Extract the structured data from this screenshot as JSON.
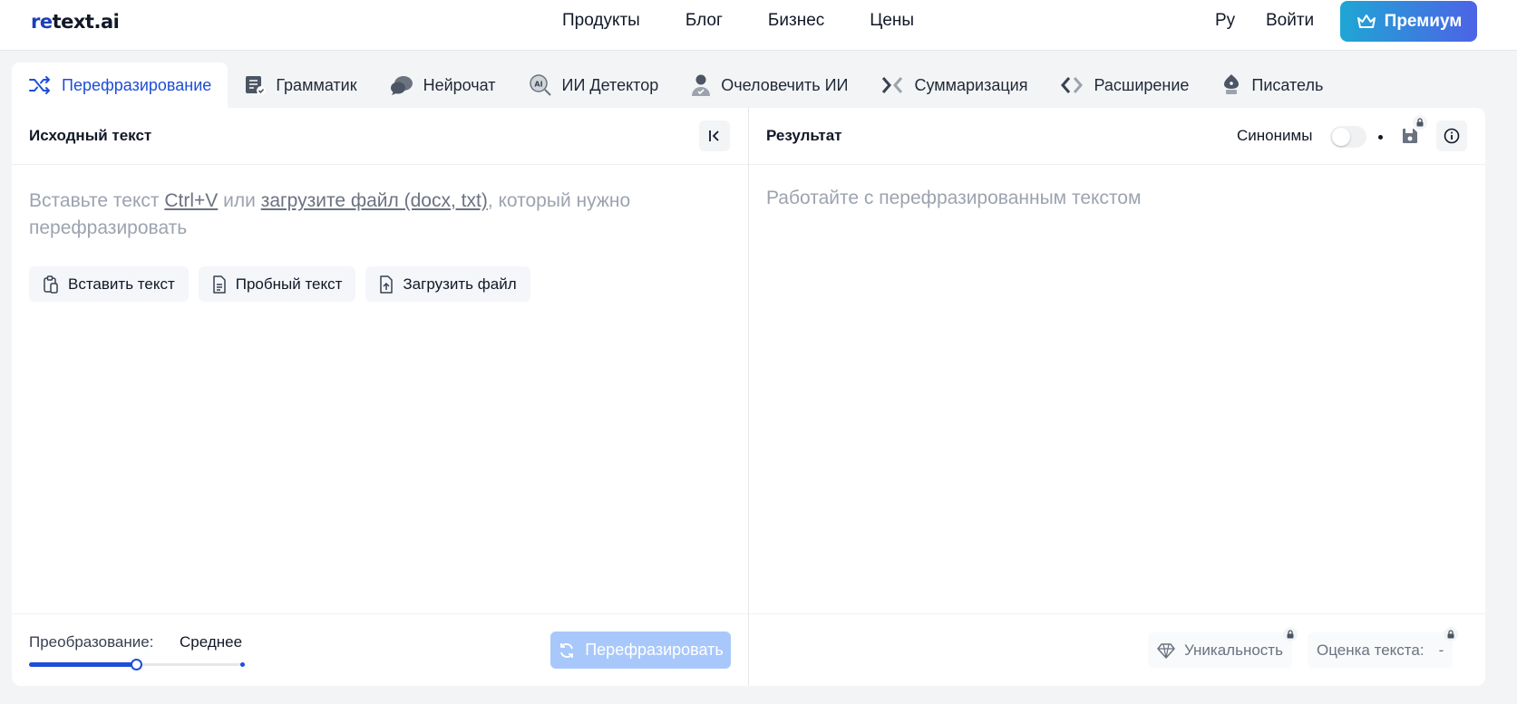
{
  "header": {
    "logo_re": "re",
    "logo_rest": "text.ai",
    "nav": [
      "Продукты",
      "Блог",
      "Бизнес",
      "Цены"
    ],
    "lang": "Ру",
    "login": "Войти",
    "premium": "Премиум"
  },
  "tabs": [
    {
      "label": "Перефразирование",
      "icon": "shuffle-icon",
      "active": true
    },
    {
      "label": "Грамматик",
      "icon": "grammar-check-icon"
    },
    {
      "label": "Нейрочат",
      "icon": "chat-bubbles-icon"
    },
    {
      "label": "ИИ Детектор",
      "icon": "ai-detector-icon"
    },
    {
      "label": "Очеловечить ИИ",
      "icon": "person-icon"
    },
    {
      "label": "Суммаризация",
      "icon": "compress-icon"
    },
    {
      "label": "Расширение",
      "icon": "expand-icon"
    },
    {
      "label": "Писатель",
      "icon": "pen-nib-icon"
    }
  ],
  "source": {
    "title": "Исходный текст",
    "placeholder_1": "Вставьте текст ",
    "placeholder_shortcut": "Ctrl+V",
    "placeholder_2": " или ",
    "placeholder_link": "загрузите файл (docx, txt)",
    "placeholder_3": ", который нужно перефразировать",
    "buttons": {
      "paste": "Вставить текст",
      "sample": "Пробный текст",
      "upload": "Загрузить файл"
    },
    "mode_label": "Преобразование:",
    "mode_value": "Среднее",
    "mode_level": 0.5,
    "run": "Перефразировать"
  },
  "result": {
    "title": "Результат",
    "synonyms": "Синонимы",
    "placeholder": "Работайте с перефразированным текстом",
    "uniqueness": "Уникальность",
    "score_label": "Оценка текста:",
    "score_value": "-"
  },
  "colors": {
    "accent": "#1d4ed8",
    "premium_start": "#1fa6d4",
    "premium_end": "#4d63e6",
    "run_disabled": "#a8c8fb"
  }
}
